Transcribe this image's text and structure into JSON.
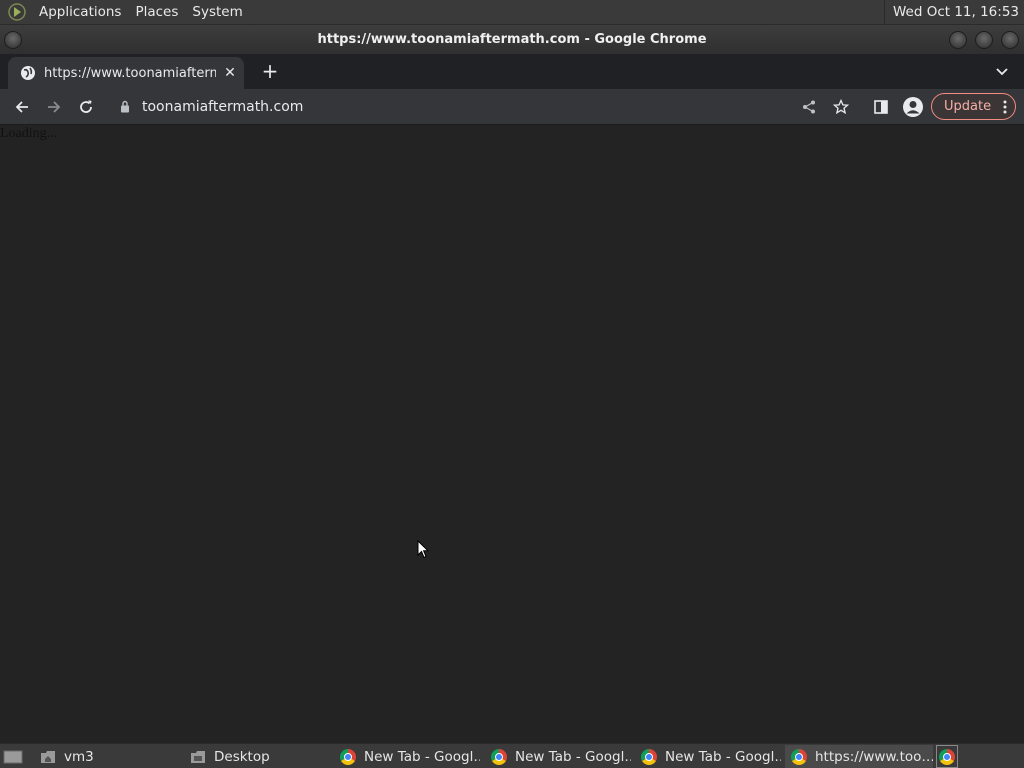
{
  "top_panel": {
    "menus": [
      "Applications",
      "Places",
      "System"
    ],
    "clock": "Wed Oct 11, 16:53"
  },
  "window": {
    "title": "https://www.toonamiaftermath.com - Google Chrome"
  },
  "tabs": [
    {
      "title": "https://www.toonamiaftermath.com",
      "icon": "globe-icon",
      "active": true
    }
  ],
  "toolbar": {
    "url": "toonamiaftermath.com",
    "update_label": "Update"
  },
  "page": {
    "text": "Loading..."
  },
  "taskbar": {
    "items": [
      {
        "label": "vm3",
        "icon": "home-folder-icon"
      },
      {
        "label": "Desktop",
        "icon": "desktop-folder-icon"
      },
      {
        "label": "New Tab - Googl…",
        "icon": "chrome-icon"
      },
      {
        "label": "New Tab - Googl…",
        "icon": "chrome-icon"
      },
      {
        "label": "New Tab - Googl…",
        "icon": "chrome-icon"
      },
      {
        "label": "https://www.too…",
        "icon": "chrome-icon",
        "active": true
      }
    ]
  },
  "colors": {
    "update_accent": "#f28b82",
    "chrome_dark": "#35363a",
    "panel": "#3a3a3a"
  }
}
